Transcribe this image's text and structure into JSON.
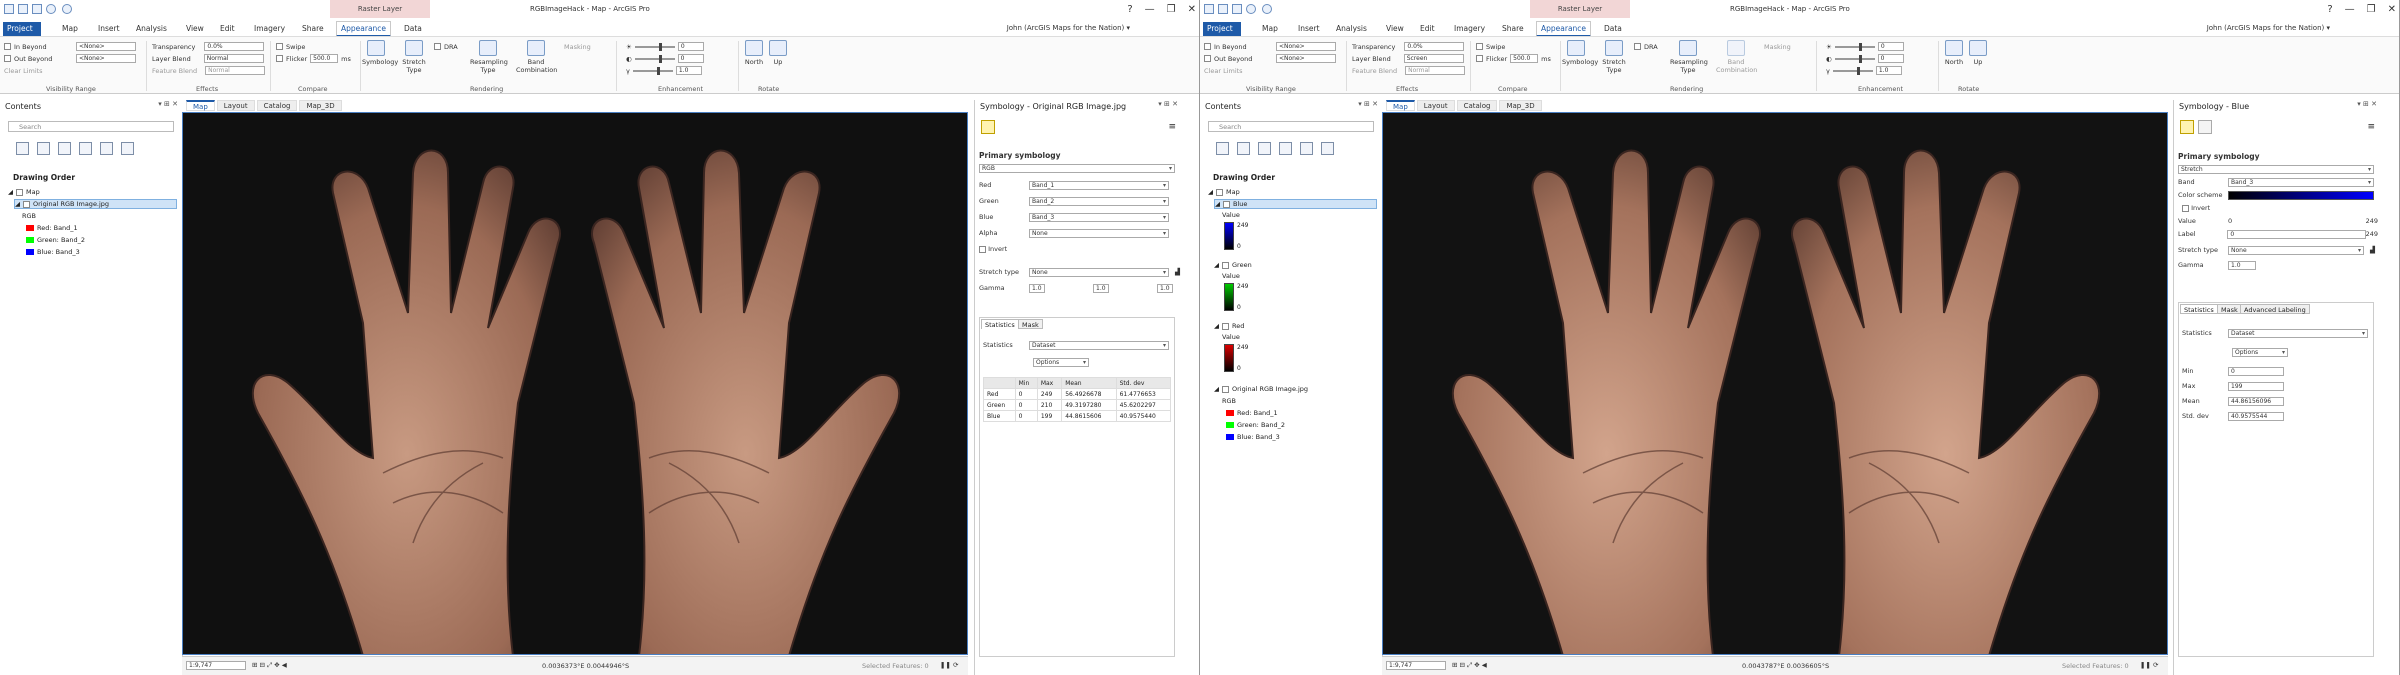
{
  "app": {
    "context_tab": "Raster Layer",
    "title": "RGBImageHack - Map - ArcGIS Pro",
    "user": "John (ArcGIS Maps for the Nation) ▾",
    "window_controls": [
      "?",
      "—",
      "❐",
      "✕"
    ],
    "tabs": [
      "Project",
      "Map",
      "Insert",
      "Analysis",
      "View",
      "Edit",
      "Imagery",
      "Share",
      "Appearance",
      "Data"
    ]
  },
  "ribbon": {
    "in_beyond": "In Beyond",
    "out_beyond": "Out Beyond",
    "clear_limits": "Clear Limits",
    "none": "<None>",
    "transparency": "Transparency",
    "transparency_val": "0.0%",
    "layer_blend": "Layer Blend",
    "feature_blend": "Feature Blend",
    "swipe": "Swipe",
    "flicker": "Flicker",
    "flicker_val": "500.0",
    "flicker_unit": "ms",
    "symbology": "Symbology",
    "stretch_type": "Stretch Type",
    "dra": "DRA",
    "resampling": "Resampling Type",
    "band_combo": "Band Combination",
    "masking": "Masking",
    "north": "North",
    "up": "Up",
    "slider_vals": [
      "0",
      "0",
      "1.0"
    ],
    "groups": [
      "Visibility Range",
      "Effects",
      "Compare",
      "Rendering",
      "Enhancement",
      "Rotate"
    ]
  },
  "left": {
    "layer_blend_val": "Normal",
    "feature_blend_val": "Normal",
    "contents": {
      "title": "Contents",
      "search": "Search",
      "drawing_order": "Drawing Order",
      "map": "Map",
      "layer": "Original RGB Image.jpg",
      "rgb": "RGB",
      "bands": [
        {
          "label": "Red:  Band_1",
          "color": "#ff0000"
        },
        {
          "label": "Green: Band_2",
          "color": "#00ff00"
        },
        {
          "label": "Blue:  Band_3",
          "color": "#0000ff"
        }
      ]
    },
    "map_tabs": [
      "Map",
      "Layout",
      "Catalog",
      "Map_3D"
    ],
    "status": {
      "scale": "1:9,747",
      "coords": "0.0036373°E 0.0044946°S",
      "selected": "Selected Features: 0"
    },
    "sym": {
      "title": "Symbology - Original RGB Image.jpg",
      "primary": "Primary symbology",
      "renderer": "RGB",
      "rows": [
        {
          "label": "Red",
          "value": "Band_1"
        },
        {
          "label": "Green",
          "value": "Band_2"
        },
        {
          "label": "Blue",
          "value": "Band_3"
        },
        {
          "label": "Alpha",
          "value": "None"
        }
      ],
      "invert": "Invert",
      "stretch_type": "Stretch type",
      "stretch_val": "None",
      "gamma": "Gamma",
      "gamma_vals": [
        "1.0",
        "1.0",
        "1.0"
      ],
      "tabs": [
        "Statistics",
        "Mask"
      ],
      "statistics": "Statistics",
      "stats_val": "Dataset",
      "options": "Options",
      "cols": [
        "",
        "Min",
        "Max",
        "Mean",
        "Std. dev"
      ],
      "rows_stats": [
        [
          "Red",
          "0",
          "249",
          "56.4926678",
          "61.4776653"
        ],
        [
          "Green",
          "0",
          "210",
          "49.3197280",
          "45.6202297"
        ],
        [
          "Blue",
          "0",
          "199",
          "44.8615606",
          "40.9575440"
        ]
      ]
    }
  },
  "right": {
    "layer_blend_val": "Screen",
    "feature_blend_val": "Normal",
    "contents": {
      "title": "Contents",
      "search": "Search",
      "drawing_order": "Drawing Order",
      "map": "Map",
      "layers": [
        {
          "name": "Blue",
          "value": "Value",
          "hi": "249",
          "lo": "0",
          "color": "#0000ff"
        },
        {
          "name": "Green",
          "value": "Value",
          "hi": "249",
          "lo": "0",
          "color": "#00cc00"
        },
        {
          "name": "Red",
          "value": "Value",
          "hi": "249",
          "lo": "0",
          "color": "#dd0000"
        }
      ],
      "orig": "Original RGB Image.jpg",
      "rgb": "RGB",
      "bands": [
        {
          "label": "Red:  Band_1",
          "color": "#ff0000"
        },
        {
          "label": "Green: Band_2",
          "color": "#00ff00"
        },
        {
          "label": "Blue:  Band_3",
          "color": "#0000ff"
        }
      ]
    },
    "map_tabs": [
      "Map",
      "Layout",
      "Catalog",
      "Map_3D"
    ],
    "status": {
      "scale": "1:9,747",
      "coords": "0.0043787°E 0.0036605°S",
      "selected": "Selected Features: 0"
    },
    "sym": {
      "title": "Symbology - Blue",
      "primary": "Primary symbology",
      "renderer": "Stretch",
      "band": "Band",
      "band_val": "Band_3",
      "color_scheme": "Color scheme",
      "invert": "Invert",
      "value": "Value",
      "value_lo": "0",
      "value_hi": "249",
      "label": "Label",
      "label_lo": "0",
      "label_hi": "249",
      "stretch_type": "Stretch type",
      "stretch_val": "None",
      "gamma": "Gamma",
      "gamma_val": "1.0",
      "tabs": [
        "Statistics",
        "Mask",
        "Advanced Labeling"
      ],
      "statistics": "Statistics",
      "stats_val": "Dataset",
      "options": "Options",
      "stats": [
        {
          "label": "Min",
          "value": "0"
        },
        {
          "label": "Max",
          "value": "199"
        },
        {
          "label": "Mean",
          "value": "44.86156096"
        },
        {
          "label": "Std. dev",
          "value": "40.9575544"
        }
      ]
    }
  }
}
